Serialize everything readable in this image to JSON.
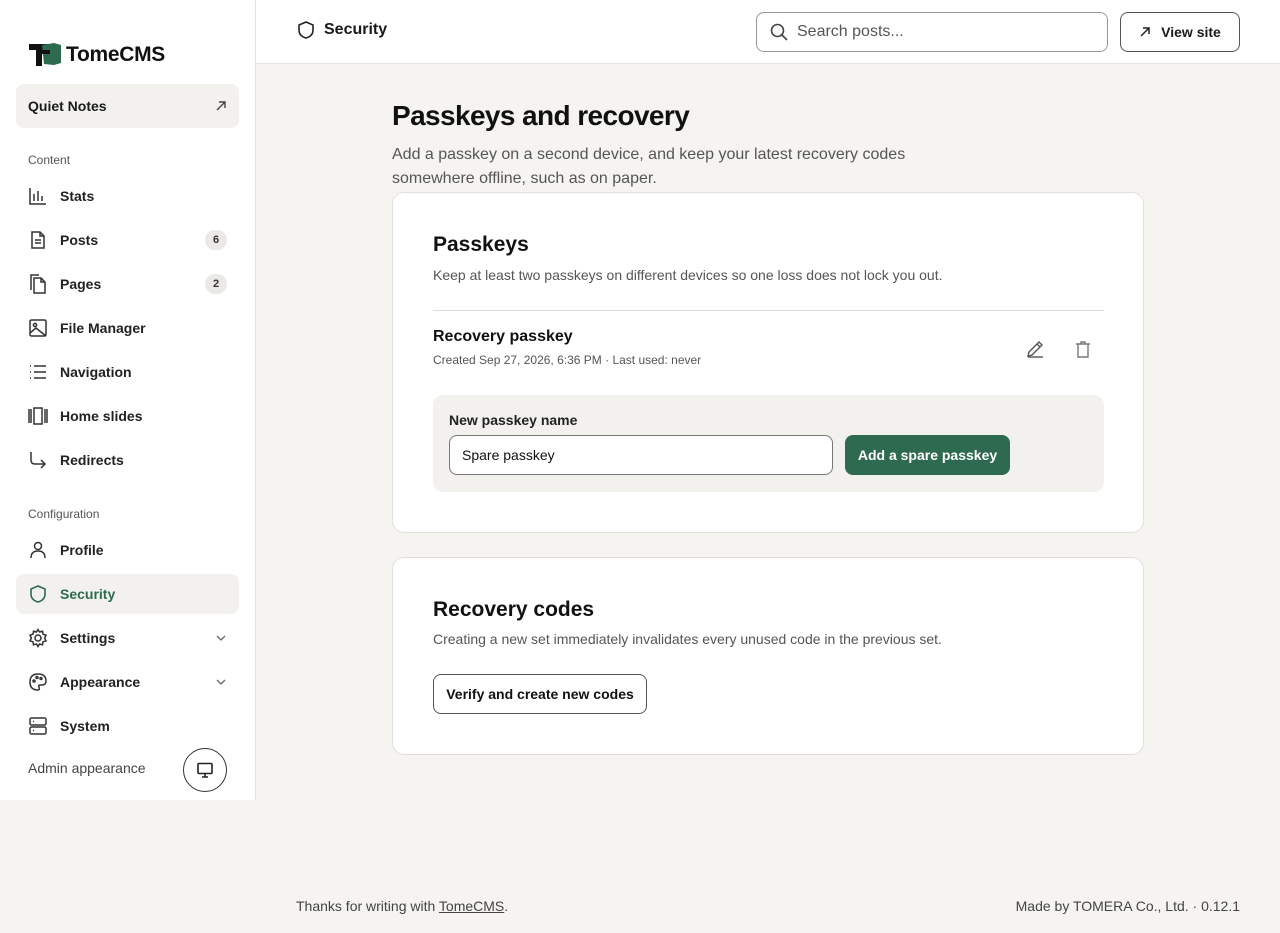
{
  "app": {
    "logo_text": "TomeCMS"
  },
  "site_card": {
    "label": "Quiet Notes"
  },
  "sidebar": {
    "content_label": "Content",
    "config_label": "Configuration",
    "content_items": [
      {
        "label": "Stats",
        "icon": "bar-chart-icon"
      },
      {
        "label": "Posts",
        "icon": "document-icon",
        "badge": "6"
      },
      {
        "label": "Pages",
        "icon": "pages-icon",
        "badge": "2"
      },
      {
        "label": "File Manager",
        "icon": "image-icon"
      },
      {
        "label": "Navigation",
        "icon": "list-icon"
      },
      {
        "label": "Home slides",
        "icon": "slides-icon"
      },
      {
        "label": "Redirects",
        "icon": "redirect-arrow-icon"
      }
    ],
    "config_items": [
      {
        "label": "Profile",
        "icon": "user-icon"
      },
      {
        "label": "Security",
        "icon": "shield-icon",
        "active": true
      },
      {
        "label": "Settings",
        "icon": "gear-icon",
        "expandable": true
      },
      {
        "label": "Appearance",
        "icon": "palette-icon",
        "expandable": true
      },
      {
        "label": "System",
        "icon": "server-icon"
      }
    ],
    "admin_appearance_label": "Admin appearance"
  },
  "topbar": {
    "breadcrumb": "Security",
    "search_placeholder": "Search posts...",
    "view_site_label": "View site"
  },
  "main": {
    "title": "Passkeys and recovery",
    "subtitle": "Add a passkey on a second device, and keep your latest recovery codes somewhere offline, such as on paper.",
    "passkeys": {
      "title": "Passkeys",
      "description": "Keep at least two passkeys on different devices so one loss does not lock you out.",
      "items": [
        {
          "name": "Recovery passkey",
          "meta": "Created Sep 27, 2026, 6:36 PM · Last used: never"
        }
      ],
      "new_label": "New passkey name",
      "new_value": "Spare passkey",
      "add_button": "Add a spare passkey"
    },
    "recovery": {
      "title": "Recovery codes",
      "description": "Creating a new set immediately invalidates every unused code in the previous set.",
      "button": "Verify and create new codes"
    }
  },
  "footer": {
    "prefix": "Thanks for writing with ",
    "link": "TomeCMS",
    "suffix": ".",
    "right": "Made by TOMERA Co., Ltd. · 0.12.1"
  },
  "colors": {
    "accent": "#2d6a4f",
    "background": "#f5f4f1",
    "surface": "#ffffff"
  }
}
